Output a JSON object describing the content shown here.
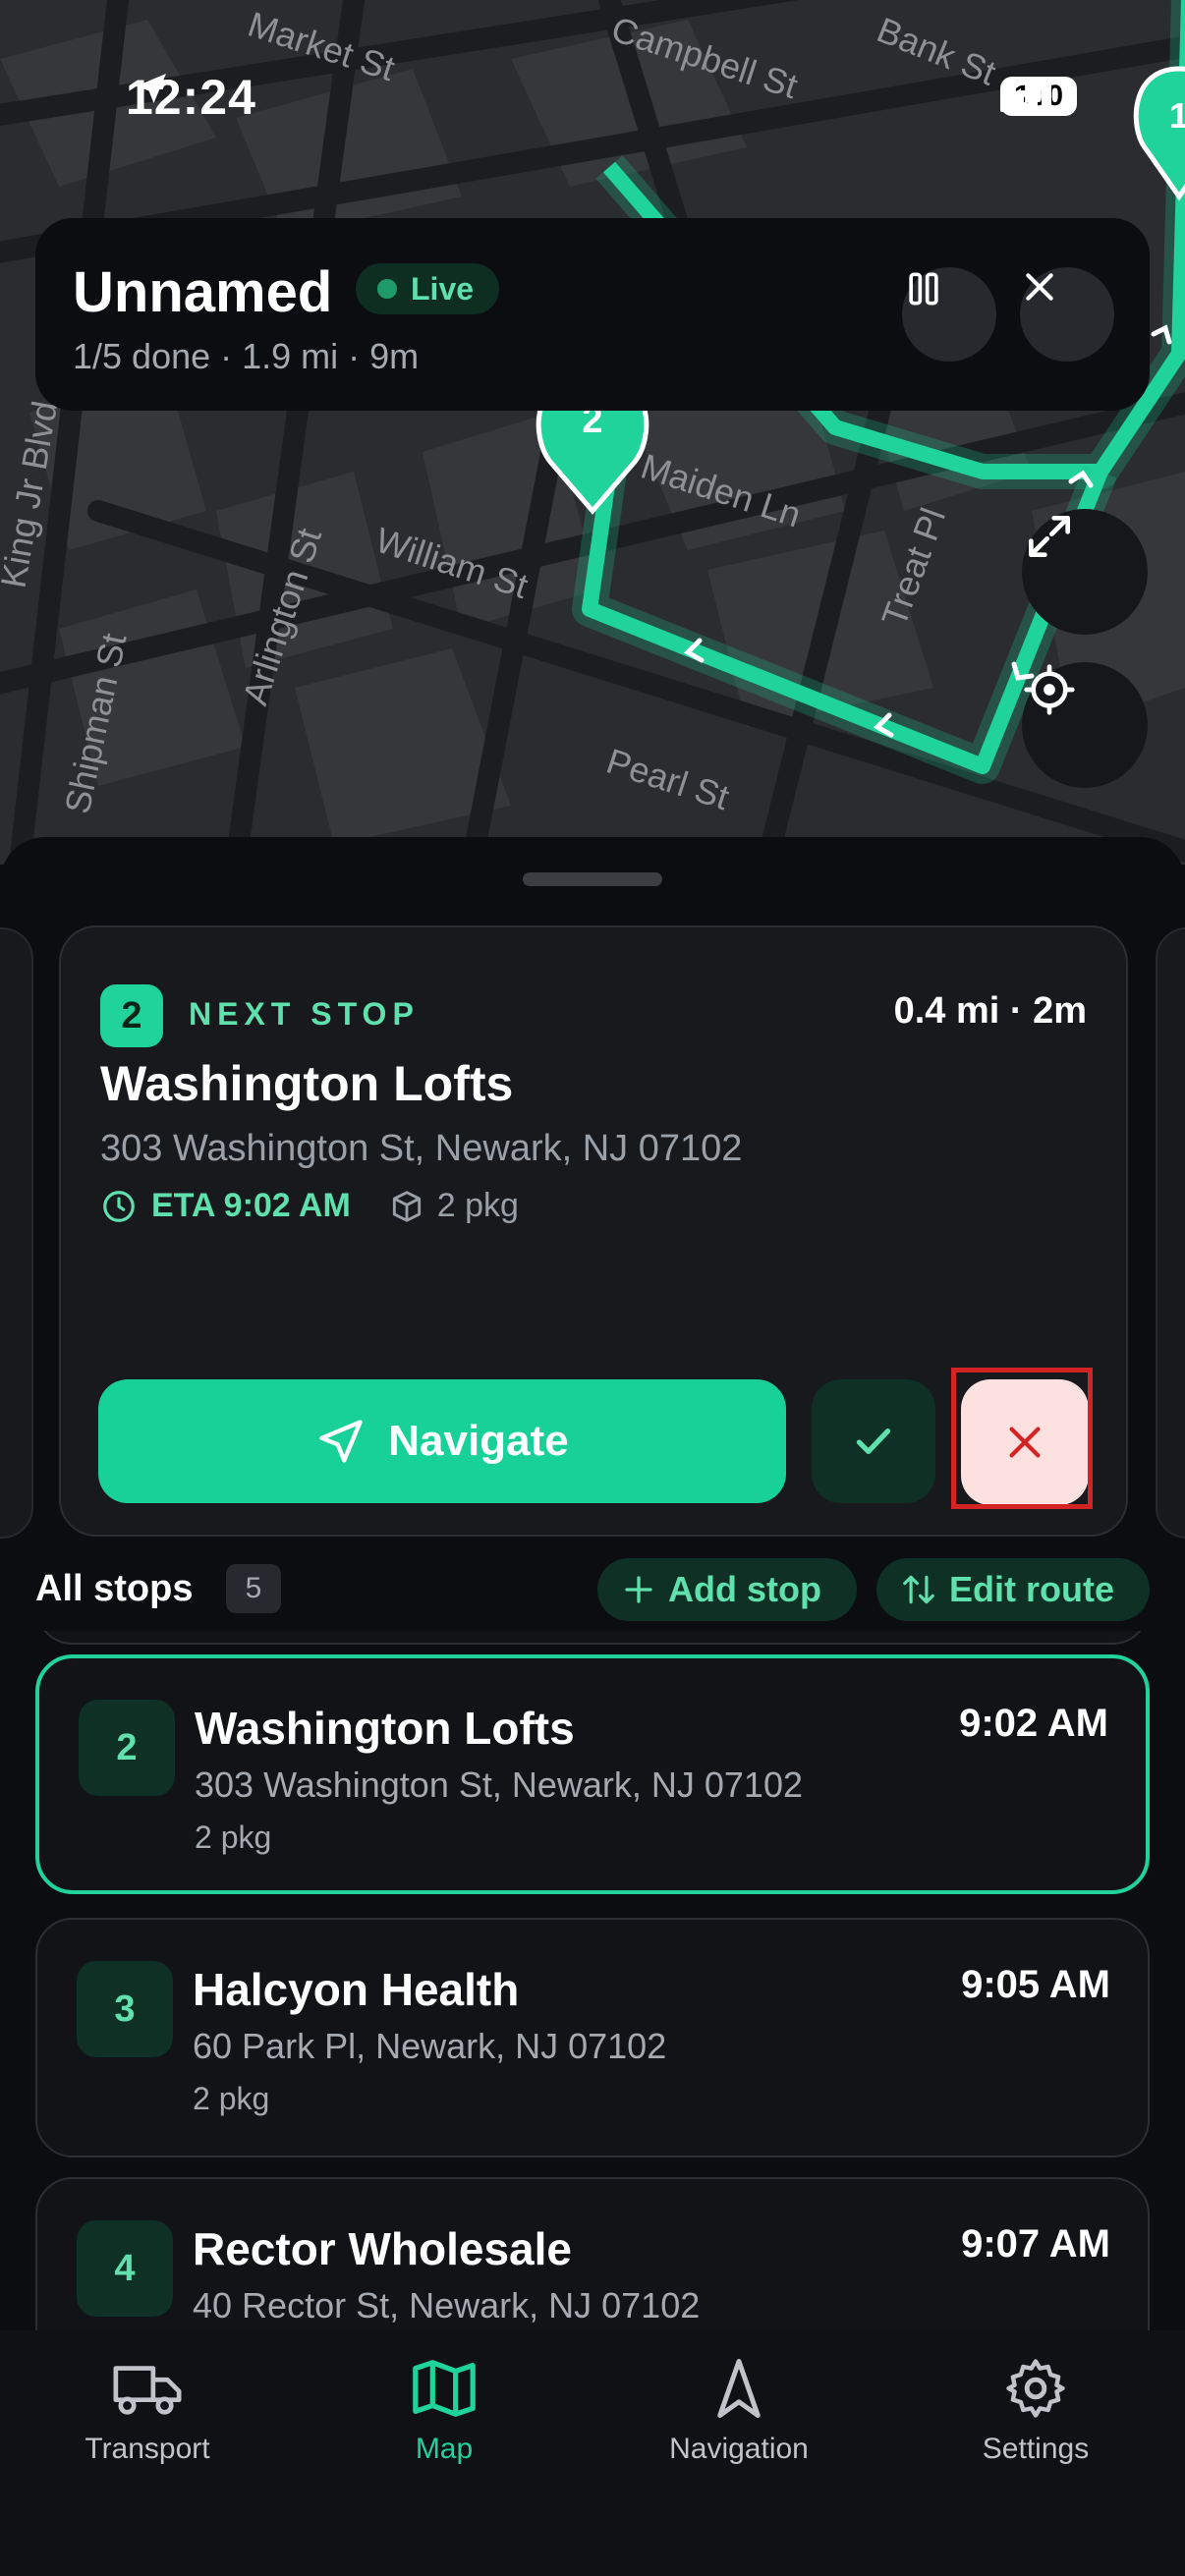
{
  "status_bar": {
    "time": "12:24",
    "battery": "100"
  },
  "map": {
    "streets": [
      "Market St",
      "Campbell St",
      "Bank St",
      "Maiden Ln",
      "William St",
      "Arlington St",
      "Shipman St",
      "Treat Pl",
      "Pearl St",
      "King Jr Blvd"
    ],
    "markers": [
      "2",
      "1"
    ]
  },
  "route": {
    "title": "Unnamed",
    "live_label": "Live",
    "summary": "1/5 done · 1.9 mi · 9m"
  },
  "next_stop": {
    "number": "2",
    "label": "NEXT STOP",
    "distance": "0.4 mi · 2m",
    "name": "Washington Lofts",
    "address": "303 Washington St, Newark, NJ 07102",
    "eta": "ETA 9:02 AM",
    "packages": "2 pkg",
    "navigate_label": "Navigate"
  },
  "stops_header": {
    "title": "All stops",
    "count": "5",
    "add_label": "Add stop",
    "edit_label": "Edit route"
  },
  "stops": [
    {
      "number": "2",
      "name": "Washington Lofts",
      "address": "303 Washington St, Newark, NJ 07102",
      "packages": "2 pkg",
      "time": "9:02 AM"
    },
    {
      "number": "3",
      "name": "Halcyon Health",
      "address": "60 Park Pl, Newark, NJ 07102",
      "packages": "2 pkg",
      "time": "9:05 AM"
    },
    {
      "number": "4",
      "name": "Rector Wholesale",
      "address": "40 Rector St, Newark, NJ 07102",
      "packages": "",
      "time": "9:07 AM"
    }
  ],
  "tabs": [
    {
      "label": "Transport"
    },
    {
      "label": "Map"
    },
    {
      "label": "Navigation"
    },
    {
      "label": "Settings"
    }
  ],
  "colors": {
    "accent": "#1fd39a",
    "danger": "#d42323",
    "background": "#0b0d10"
  }
}
